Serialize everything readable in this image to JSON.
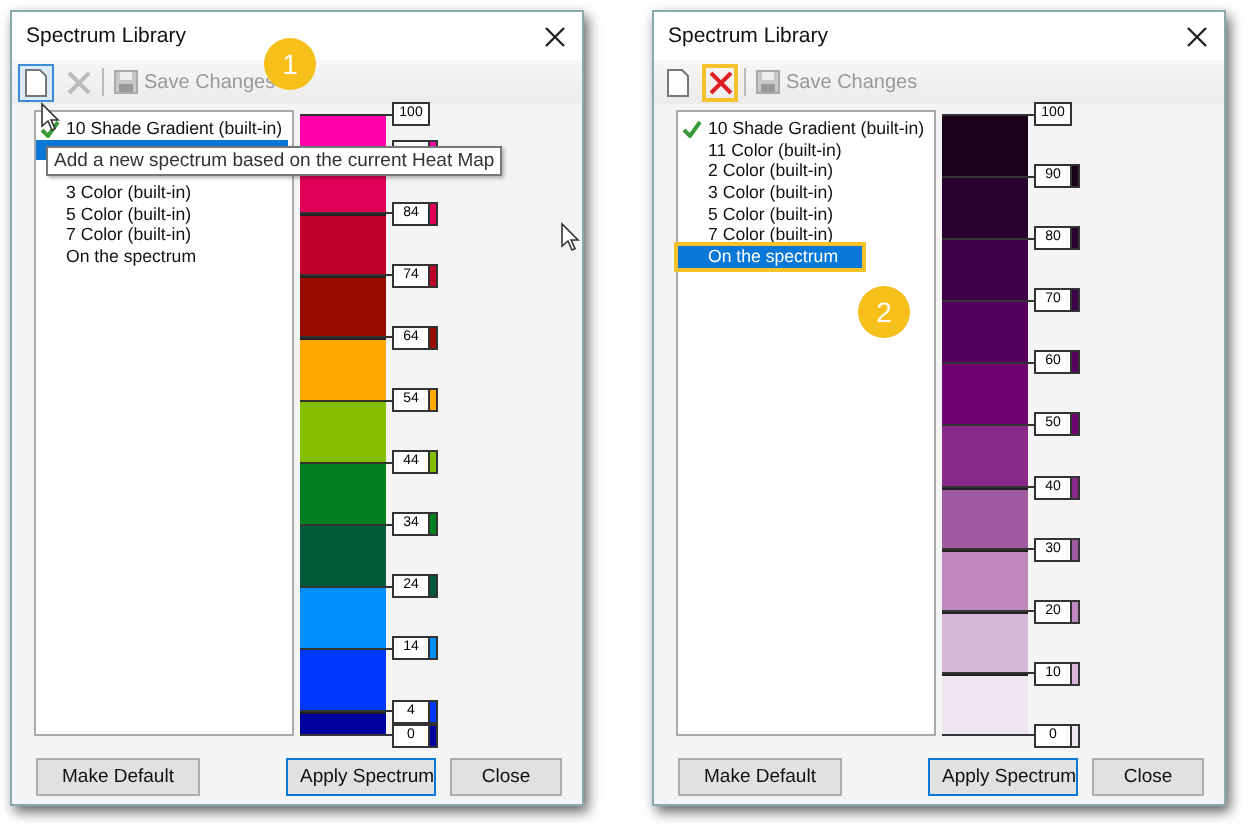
{
  "dialogs": [
    {
      "title": "Spectrum Library",
      "cursor": true,
      "toolbar": {
        "new_highlighted": true,
        "delete_enabled": false,
        "delete_highlighted": false,
        "save_label": "Save Changes",
        "save_enabled": false
      },
      "badge": {
        "label": "1"
      },
      "tooltip": "Add a new spectrum based on the current Heat Map",
      "items": [
        {
          "label": "10 Shade Gradient (built-in)",
          "checked": true,
          "selected": false,
          "highlighted": false
        },
        {
          "checked": false,
          "selected": true,
          "highlighted": false
        },
        {
          "checked": false,
          "selected": false,
          "highlighted": false
        },
        {
          "label": "3 Color (built-in)",
          "checked": false,
          "selected": false,
          "highlighted": false
        },
        {
          "label": "5 Color (built-in)",
          "checked": false,
          "selected": false,
          "highlighted": false
        },
        {
          "label": "7 Color (built-in)",
          "checked": false,
          "selected": false,
          "highlighted": false
        },
        {
          "label": "On the spectrum",
          "checked": false,
          "selected": false,
          "highlighted": false
        }
      ],
      "scale": {
        "top_label": "100",
        "bands": [
          {
            "kind": "short",
            "color": "#ff00aa"
          },
          {
            "kind": "full",
            "color": "#e0005a",
            "label": "84"
          },
          {
            "kind": "full",
            "color": "#c0002a",
            "label": "74"
          },
          {
            "kind": "full",
            "color": "#960c00",
            "label": "64"
          },
          {
            "kind": "full",
            "color": "#ffa800",
            "label": "54"
          },
          {
            "kind": "full",
            "color": "#84c000",
            "label": "44"
          },
          {
            "kind": "full",
            "color": "#00801e",
            "label": "34"
          },
          {
            "kind": "full",
            "color": "#005a38",
            "label": "24"
          },
          {
            "kind": "full",
            "color": "#0090ff",
            "label": "14"
          },
          {
            "kind": "full",
            "color": "#0038ff",
            "label": "4"
          },
          {
            "kind": "thin",
            "color": "#0000a0",
            "label": "0"
          }
        ]
      },
      "buttons": [
        {
          "label": "Make Default",
          "default": false
        },
        {
          "label": "Apply Spectrum",
          "default": true
        },
        {
          "label": "Close",
          "default": false
        }
      ]
    },
    {
      "title": "Spectrum Library",
      "cursor": false,
      "toolbar": {
        "new_highlighted": false,
        "delete_enabled": true,
        "delete_highlighted": true,
        "save_label": "Save Changes",
        "save_enabled": false
      },
      "badge": {
        "label": "2"
      },
      "items": [
        {
          "label": "10 Shade Gradient (built-in)",
          "checked": true,
          "selected": false,
          "highlighted": false
        },
        {
          "label": "11 Color (built-in)",
          "checked": false,
          "selected": false,
          "highlighted": false
        },
        {
          "label": "2 Color (built-in)",
          "checked": false,
          "selected": false,
          "highlighted": false
        },
        {
          "label": "3 Color (built-in)",
          "checked": false,
          "selected": false,
          "highlighted": false
        },
        {
          "label": "5 Color (built-in)",
          "checked": false,
          "selected": false,
          "highlighted": false
        },
        {
          "label": "7 Color (built-in)",
          "checked": false,
          "selected": false,
          "highlighted": false
        },
        {
          "label": "On the spectrum",
          "checked": false,
          "selected": true,
          "highlighted": true
        }
      ],
      "scale": {
        "top_label": "100",
        "bands": [
          {
            "kind": "full",
            "color": "#1a0018",
            "label": "90"
          },
          {
            "kind": "full",
            "color": "#2a0030",
            "label": "80"
          },
          {
            "kind": "full",
            "color": "#3e0048",
            "label": "70"
          },
          {
            "kind": "full",
            "color": "#55005e",
            "label": "60"
          },
          {
            "kind": "full",
            "color": "#700070",
            "label": "50"
          },
          {
            "kind": "full",
            "color": "#8a2a88",
            "label": "40"
          },
          {
            "kind": "full",
            "color": "#a05aa0",
            "label": "30"
          },
          {
            "kind": "full",
            "color": "#bf88bf",
            "label": "20"
          },
          {
            "kind": "full",
            "color": "#d8b8d8",
            "label": "10"
          },
          {
            "kind": "full",
            "color": "#f0e4f0",
            "label": "0"
          }
        ]
      },
      "buttons": [
        {
          "label": "Make Default",
          "default": false
        },
        {
          "label": "Apply Spectrum",
          "default": true
        },
        {
          "label": "Close",
          "default": false
        }
      ]
    }
  ]
}
